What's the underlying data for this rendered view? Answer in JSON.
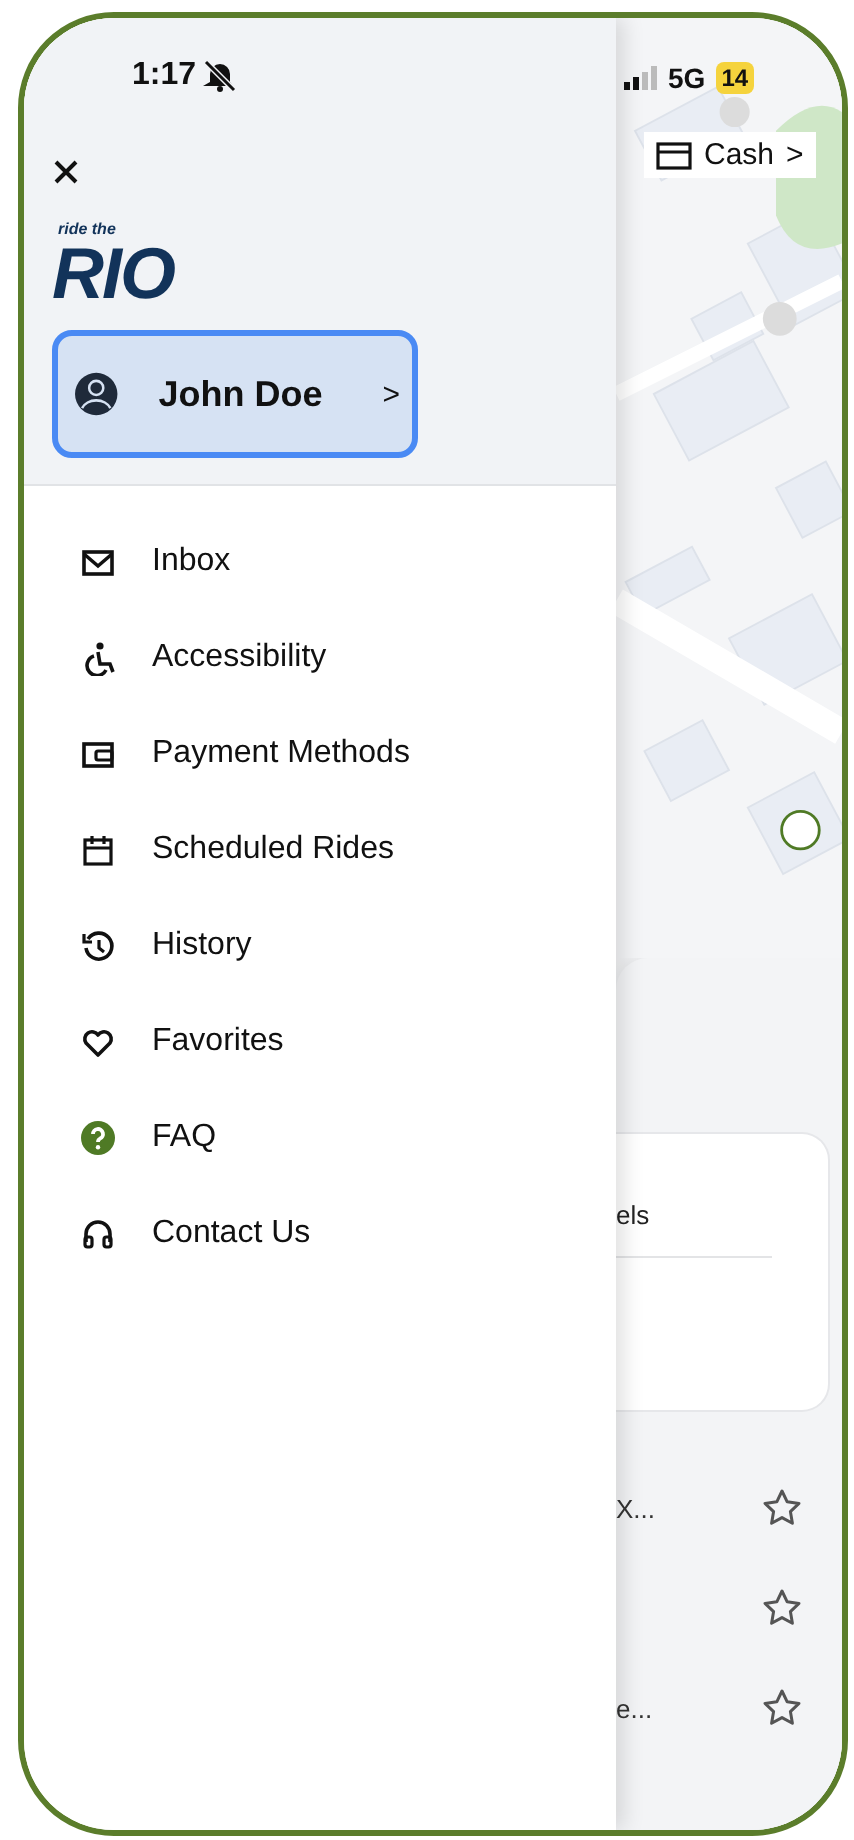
{
  "status_bar": {
    "time": "1:17",
    "network": "5G",
    "battery": "14"
  },
  "drawer": {
    "logo": {
      "tagline": "ride the",
      "name": "RIO"
    },
    "profile": {
      "name": "John Doe",
      "chevron": ">"
    },
    "menu": [
      {
        "label": "Inbox"
      },
      {
        "label": "Accessibility"
      },
      {
        "label": "Payment Methods"
      },
      {
        "label": "Scheduled Rides"
      },
      {
        "label": "History"
      },
      {
        "label": "Favorites"
      },
      {
        "label": "FAQ"
      },
      {
        "label": "Contact Us"
      }
    ]
  },
  "map": {
    "payment_chip": {
      "label": "Cash",
      "chevron": ">"
    }
  },
  "sheet": {
    "card_text": "els",
    "places": [
      {
        "label": "X...",
        "favorite": false
      },
      {
        "favorite": false
      },
      {
        "label": "e...",
        "favorite": false
      }
    ]
  }
}
